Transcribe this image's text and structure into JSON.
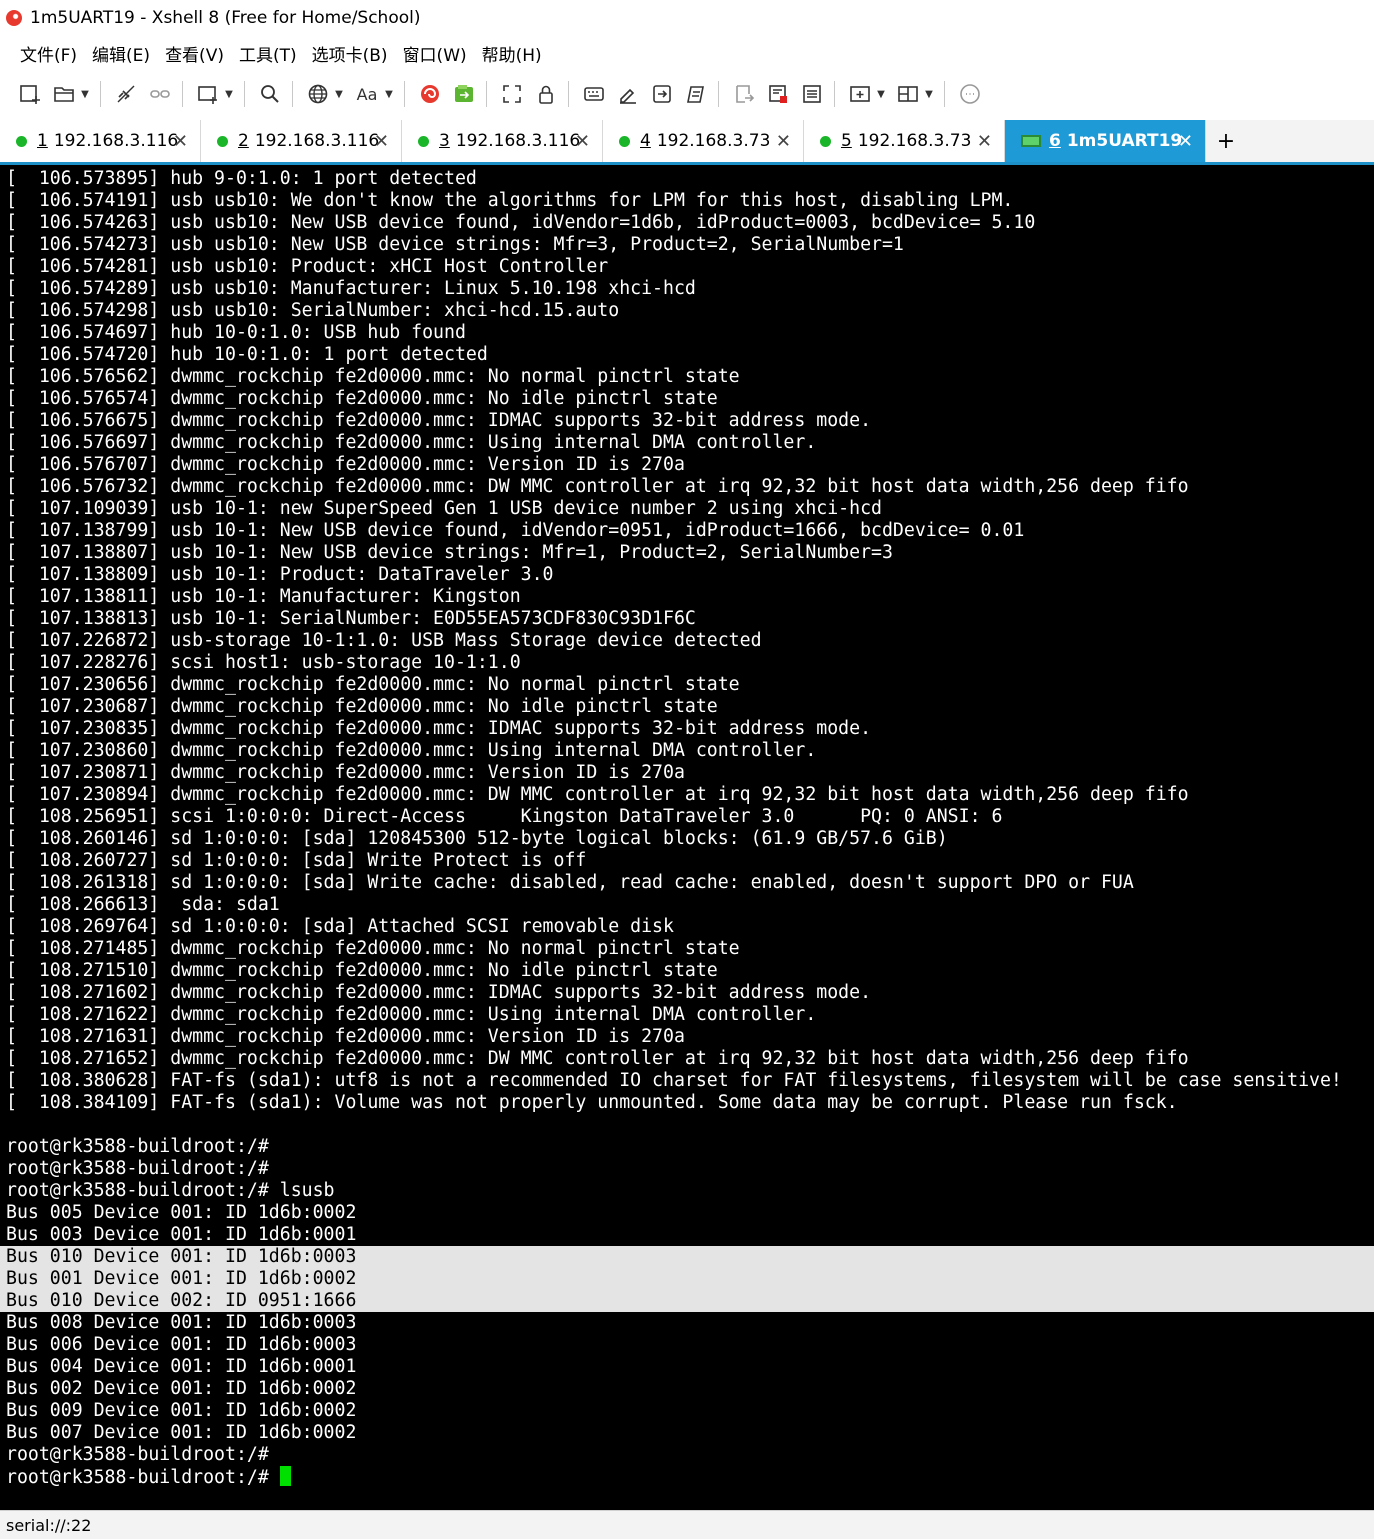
{
  "window": {
    "title": "1m5UART19 - Xshell 8 (Free for Home/School)"
  },
  "menu": [
    "文件(F)",
    "编辑(E)",
    "查看(V)",
    "工具(T)",
    "选项卡(B)",
    "窗口(W)",
    "帮助(H)"
  ],
  "toolbar": {
    "icons": [
      "new-session-icon",
      "open-folder-icon",
      "disconnect-icon",
      "reconnect-icon",
      "new-tab-icon",
      "search-icon",
      "globe-icon",
      "font-icon",
      "xshell-icon",
      "xftp-icon",
      "fullscreen-icon",
      "lock-icon",
      "keyboard-icon",
      "compose-icon",
      "send-icon",
      "script-icon",
      "log-icon",
      "record-icon",
      "properties-icon",
      "transfer-icon",
      "layout-icon",
      "chat-icon"
    ],
    "font_label": "Aa"
  },
  "tabs": [
    {
      "num": "1",
      "label": "192.168.3.116",
      "status": "connected",
      "active": false
    },
    {
      "num": "2",
      "label": "192.168.3.116",
      "status": "connected",
      "active": false
    },
    {
      "num": "3",
      "label": "192.168.3.116",
      "status": "connected",
      "active": false
    },
    {
      "num": "4",
      "label": "192.168.3.73",
      "status": "connected",
      "active": false
    },
    {
      "num": "5",
      "label": "192.168.3.73",
      "status": "connected",
      "active": false
    },
    {
      "num": "6",
      "label": "1m5UART19",
      "status": "serial",
      "active": true
    }
  ],
  "tab_close_glyph": "✕",
  "add_tab_glyph": "+",
  "colors": {
    "accent": "#1e9ad6",
    "status_dot": "#1bb52a",
    "cursor": "#00e000",
    "selection": "#e4e4e4"
  },
  "terminal": {
    "lines": [
      "[  106.573895] hub 9-0:1.0: 1 port detected",
      "[  106.574191] usb usb10: We don't know the algorithms for LPM for this host, disabling LPM.",
      "[  106.574263] usb usb10: New USB device found, idVendor=1d6b, idProduct=0003, bcdDevice= 5.10",
      "[  106.574273] usb usb10: New USB device strings: Mfr=3, Product=2, SerialNumber=1",
      "[  106.574281] usb usb10: Product: xHCI Host Controller",
      "[  106.574289] usb usb10: Manufacturer: Linux 5.10.198 xhci-hcd",
      "[  106.574298] usb usb10: SerialNumber: xhci-hcd.15.auto",
      "[  106.574697] hub 10-0:1.0: USB hub found",
      "[  106.574720] hub 10-0:1.0: 1 port detected",
      "[  106.576562] dwmmc_rockchip fe2d0000.mmc: No normal pinctrl state",
      "[  106.576574] dwmmc_rockchip fe2d0000.mmc: No idle pinctrl state",
      "[  106.576675] dwmmc_rockchip fe2d0000.mmc: IDMAC supports 32-bit address mode.",
      "[  106.576697] dwmmc_rockchip fe2d0000.mmc: Using internal DMA controller.",
      "[  106.576707] dwmmc_rockchip fe2d0000.mmc: Version ID is 270a",
      "[  106.576732] dwmmc_rockchip fe2d0000.mmc: DW MMC controller at irq 92,32 bit host data width,256 deep fifo",
      "[  107.109039] usb 10-1: new SuperSpeed Gen 1 USB device number 2 using xhci-hcd",
      "[  107.138799] usb 10-1: New USB device found, idVendor=0951, idProduct=1666, bcdDevice= 0.01",
      "[  107.138807] usb 10-1: New USB device strings: Mfr=1, Product=2, SerialNumber=3",
      "[  107.138809] usb 10-1: Product: DataTraveler 3.0",
      "[  107.138811] usb 10-1: Manufacturer: Kingston",
      "[  107.138813] usb 10-1: SerialNumber: E0D55EA573CDF830C93D1F6C",
      "[  107.226872] usb-storage 10-1:1.0: USB Mass Storage device detected",
      "[  107.228276] scsi host1: usb-storage 10-1:1.0",
      "[  107.230656] dwmmc_rockchip fe2d0000.mmc: No normal pinctrl state",
      "[  107.230687] dwmmc_rockchip fe2d0000.mmc: No idle pinctrl state",
      "[  107.230835] dwmmc_rockchip fe2d0000.mmc: IDMAC supports 32-bit address mode.",
      "[  107.230860] dwmmc_rockchip fe2d0000.mmc: Using internal DMA controller.",
      "[  107.230871] dwmmc_rockchip fe2d0000.mmc: Version ID is 270a",
      "[  107.230894] dwmmc_rockchip fe2d0000.mmc: DW MMC controller at irq 92,32 bit host data width,256 deep fifo",
      "[  108.256951] scsi 1:0:0:0: Direct-Access     Kingston DataTraveler 3.0      PQ: 0 ANSI: 6",
      "[  108.260146] sd 1:0:0:0: [sda] 120845300 512-byte logical blocks: (61.9 GB/57.6 GiB)",
      "[  108.260727] sd 1:0:0:0: [sda] Write Protect is off",
      "[  108.261318] sd 1:0:0:0: [sda] Write cache: disabled, read cache: enabled, doesn't support DPO or FUA",
      "[  108.266613]  sda: sda1",
      "[  108.269764] sd 1:0:0:0: [sda] Attached SCSI removable disk",
      "[  108.271485] dwmmc_rockchip fe2d0000.mmc: No normal pinctrl state",
      "[  108.271510] dwmmc_rockchip fe2d0000.mmc: No idle pinctrl state",
      "[  108.271602] dwmmc_rockchip fe2d0000.mmc: IDMAC supports 32-bit address mode.",
      "[  108.271622] dwmmc_rockchip fe2d0000.mmc: Using internal DMA controller.",
      "[  108.271631] dwmmc_rockchip fe2d0000.mmc: Version ID is 270a",
      "[  108.271652] dwmmc_rockchip fe2d0000.mmc: DW MMC controller at irq 92,32 bit host data width,256 deep fifo",
      "[  108.380628] FAT-fs (sda1): utf8 is not a recommended IO charset for FAT filesystems, filesystem will be case sensitive!",
      "[  108.384109] FAT-fs (sda1): Volume was not properly unmounted. Some data may be corrupt. Please run fsck.",
      "",
      "root@rk3588-buildroot:/#",
      "root@rk3588-buildroot:/#",
      "root@rk3588-buildroot:/# lsusb",
      "Bus 005 Device 001: ID 1d6b:0002",
      "Bus 003 Device 001: ID 1d6b:0001",
      "Bus 010 Device 001: ID 1d6b:0003",
      "Bus 001 Device 001: ID 1d6b:0002",
      "Bus 010 Device 002: ID 0951:1666",
      "Bus 008 Device 001: ID 1d6b:0003",
      "Bus 006 Device 001: ID 1d6b:0003",
      "Bus 004 Device 001: ID 1d6b:0001",
      "Bus 002 Device 001: ID 1d6b:0002",
      "Bus 009 Device 001: ID 1d6b:0002",
      "Bus 007 Device 001: ID 1d6b:0002",
      "root@rk3588-buildroot:/#",
      "root@rk3588-buildroot:/# "
    ],
    "highlighted_lines": [
      49,
      50,
      51
    ]
  },
  "status": {
    "text": "serial://:22"
  }
}
